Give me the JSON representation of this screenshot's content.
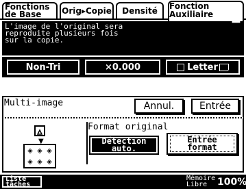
{
  "tabs": {
    "fonctions_line1": "Fonctions",
    "fonctions_line2": "de Base",
    "orig_copie": "Orig▸Copie",
    "densite": "Densité",
    "aux_line1": "Fonction",
    "aux_line2": "Auxiliaire"
  },
  "message": {
    "line1": "L'image de l'original sera",
    "line2": "reproduite plusieurs fois",
    "line3": "sur la copie.",
    "count": "1"
  },
  "status": {
    "sort": "Non-Tri",
    "zoom": "×0.000",
    "paper": "Letter"
  },
  "panel": {
    "title": "Multi-image",
    "annul": "Annul.",
    "entree": "Entrée",
    "format_title": "Format original",
    "detection_line1": "Détection",
    "detection_line2": "auto.",
    "entree_format_line1": "Entrée",
    "entree_format_line2": "format"
  },
  "bottom": {
    "liste_line1": "Liste",
    "liste_line2": "tâches",
    "memoire_line1": "Mémoire",
    "memoire_line2": "Libre",
    "memoire_pct": "100%"
  }
}
